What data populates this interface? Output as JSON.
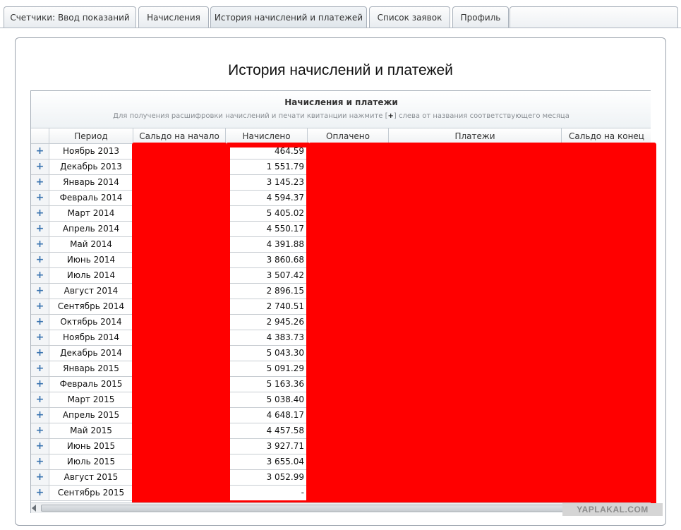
{
  "tabs": [
    {
      "label": "Счетчики: Ввод показаний",
      "active": false
    },
    {
      "label": "Начисления",
      "active": false
    },
    {
      "label": "История начислений и платежей",
      "active": true
    },
    {
      "label": "Список заявок",
      "active": false
    },
    {
      "label": "Профиль",
      "active": false
    }
  ],
  "page_title": "История начислений и платежей",
  "grid": {
    "title": "Начисления и платежи",
    "hint_before": "Для получения расшифровки начислений и печати квитанции нажмите [",
    "hint_plus": "+",
    "hint_after": "] слева от названия соответствующего месяца",
    "columns": [
      "Период",
      "Сальдо на начало",
      "Начислено",
      "Оплачено",
      "Платежи",
      "Сальдо на конец"
    ],
    "expander_symbol": "+",
    "rows": [
      {
        "period": "Ноябрь 2013",
        "charged": "464.59"
      },
      {
        "period": "Декабрь 2013",
        "charged": "1 551.79"
      },
      {
        "period": "Январь 2014",
        "charged": "3 145.23"
      },
      {
        "period": "Февраль 2014",
        "charged": "4 594.37"
      },
      {
        "period": "Март 2014",
        "charged": "5 405.02"
      },
      {
        "period": "Апрель 2014",
        "charged": "4 550.17"
      },
      {
        "period": "Май 2014",
        "charged": "4 391.88"
      },
      {
        "period": "Июнь 2014",
        "charged": "3 860.68"
      },
      {
        "period": "Июль 2014",
        "charged": "3 507.42"
      },
      {
        "period": "Август 2014",
        "charged": "2 896.15"
      },
      {
        "period": "Сентябрь 2014",
        "charged": "2 740.51"
      },
      {
        "period": "Октябрь 2014",
        "charged": "2 945.26"
      },
      {
        "period": "Ноябрь 2014",
        "charged": "4 383.73"
      },
      {
        "period": "Декабрь 2014",
        "charged": "5 043.30"
      },
      {
        "period": "Январь 2015",
        "charged": "5 091.29"
      },
      {
        "period": "Февраль 2015",
        "charged": "5 163.36"
      },
      {
        "period": "Март 2015",
        "charged": "5 038.40"
      },
      {
        "period": "Апрель 2015",
        "charged": "4 648.17"
      },
      {
        "period": "Май 2015",
        "charged": "4 457.58"
      },
      {
        "period": "Июнь 2015",
        "charged": "3 927.71"
      },
      {
        "period": "Июль 2015",
        "charged": "3 655.04"
      },
      {
        "period": "Август 2015",
        "charged": "3 052.99"
      },
      {
        "period": "Сентябрь 2015",
        "charged": "-"
      }
    ]
  },
  "watermark": "YAPLAKAL.COM",
  "colors": {
    "redaction": "#ff0000",
    "expander": "#3a74b0"
  }
}
